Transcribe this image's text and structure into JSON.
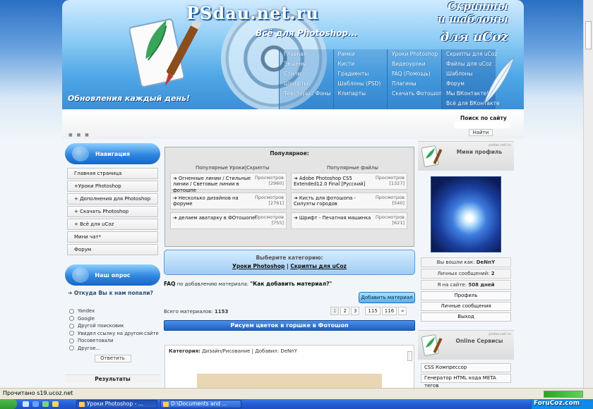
{
  "header": {
    "site_title": "PSdau.net.ru",
    "tagline": "Всё для Photoshop...",
    "motto": "Обновления каждый день!",
    "brand_line1": "Скрипты",
    "brand_line2": "и шаблоны",
    "brand_line3": "для uCoz",
    "menu_columns": [
      [
        "Главная",
        "Экшены",
        "Стили",
        "Шрифты",
        "Текстуры / Фоны"
      ],
      [
        "Рамки",
        "Кисти",
        "Градиенты",
        "Шаблоны (PSD)",
        "Клипарты"
      ],
      [
        "Уроки Photoshop",
        "Видеоуроки",
        "FAQ (Помощь)",
        "Плагины",
        "Скачать Фотошоп"
      ],
      [
        "Скрипты для uCoz",
        "Файлы для uCoz",
        "Шаблоны",
        "Форум",
        "Мы ВКонтакте!",
        "Всё для ВКонтакте"
      ]
    ]
  },
  "search": {
    "title": "Поиск по сайту",
    "button": "Найти"
  },
  "left": {
    "nav_title": "Навигация",
    "nav_items": [
      "Главная страница",
      "+Уроки Photoshop",
      "+ Дополнения для Photoshop",
      "+ Скачать Photoshop",
      "+ Всё для uCoz",
      "Мини чат*",
      "Форум"
    ],
    "poll_title": "Наш опрос",
    "poll_question": "Откуда Вы к нам попали?",
    "poll_options": [
      "Yandex",
      "Google",
      "Другой поисковик",
      "Увидел ссылку на другом сайте",
      "Посоветовали",
      "Другое..."
    ],
    "vote_button": "Ответить",
    "results": "Результаты"
  },
  "main": {
    "popular_title": "Популярное:",
    "popular_left_heading": "Популярные Уроки|Скрипты",
    "popular_right_heading": "Популярные файлы",
    "views_label": "Просмотров",
    "popular_left": [
      {
        "title": "Огненные линии / Стильные линии / Световые линии в фотошпе",
        "views": "[2960]"
      },
      {
        "title": "Несколько дизайнов на форуме",
        "views": "[2761]"
      },
      {
        "title": "делаем аватарку в ФОтошопе!",
        "views": "[755]"
      }
    ],
    "popular_right": [
      {
        "title": "Adobe Photoshop CS5 Extended12.0 Final [Русский]",
        "views": "[1327]"
      },
      {
        "title": "Кисть для фотошопа - Силуэты городов",
        "views": "[540]"
      },
      {
        "title": "Шрифт - Печатная машинка",
        "views": "[621]"
      }
    ],
    "category_title": "Выберите категорию:",
    "category_link1": "Уроки Photoshop",
    "category_sep": "|",
    "category_link2": "Скрипты для uCoz",
    "faq_prefix": "FAQ",
    "faq_text": "по добавлению материала:",
    "faq_link": "\"Как добавить материал?\"",
    "add_button": "Добавить материал",
    "total_label": "Всего материалов:",
    "total_value": "1153",
    "pages": [
      "1",
      "2",
      "3",
      "115",
      "116",
      "»"
    ],
    "entry_title": "Рисуем цветок в горшке в Фотошоп",
    "entry_meta_label": "Категория:",
    "entry_meta_value": "Дизайн/Рисование | Добавил: DeNnY"
  },
  "right": {
    "profile_title": "Мини профиль",
    "watermark": "psdau.net.ru",
    "logged_label": "Вы вошли как:",
    "logged_user": "DeNnY",
    "messages_label": "Личных сообщений:",
    "messages_value": "2",
    "days_label": "Я на сайте:",
    "days_value": "508 дней",
    "buttons": [
      "Профиль",
      "Личные сообщения",
      "Выход"
    ],
    "services_title": "Online Сервисы",
    "services": [
      "CSS Компрессор",
      "Генератор HTML кода META тегов"
    ]
  },
  "statusbar": {
    "text": "Прочитано s19.ucoz.net"
  },
  "taskbar": {
    "tasks": [
      "Уроки Photoshop - ...",
      "D:\\Documents and ..."
    ],
    "brand": "ForuCoz.com"
  },
  "colors": {
    "accent_blue": "#2f86e0",
    "entry_bar": "#1c5fc6",
    "taskbar": "#245edb"
  }
}
